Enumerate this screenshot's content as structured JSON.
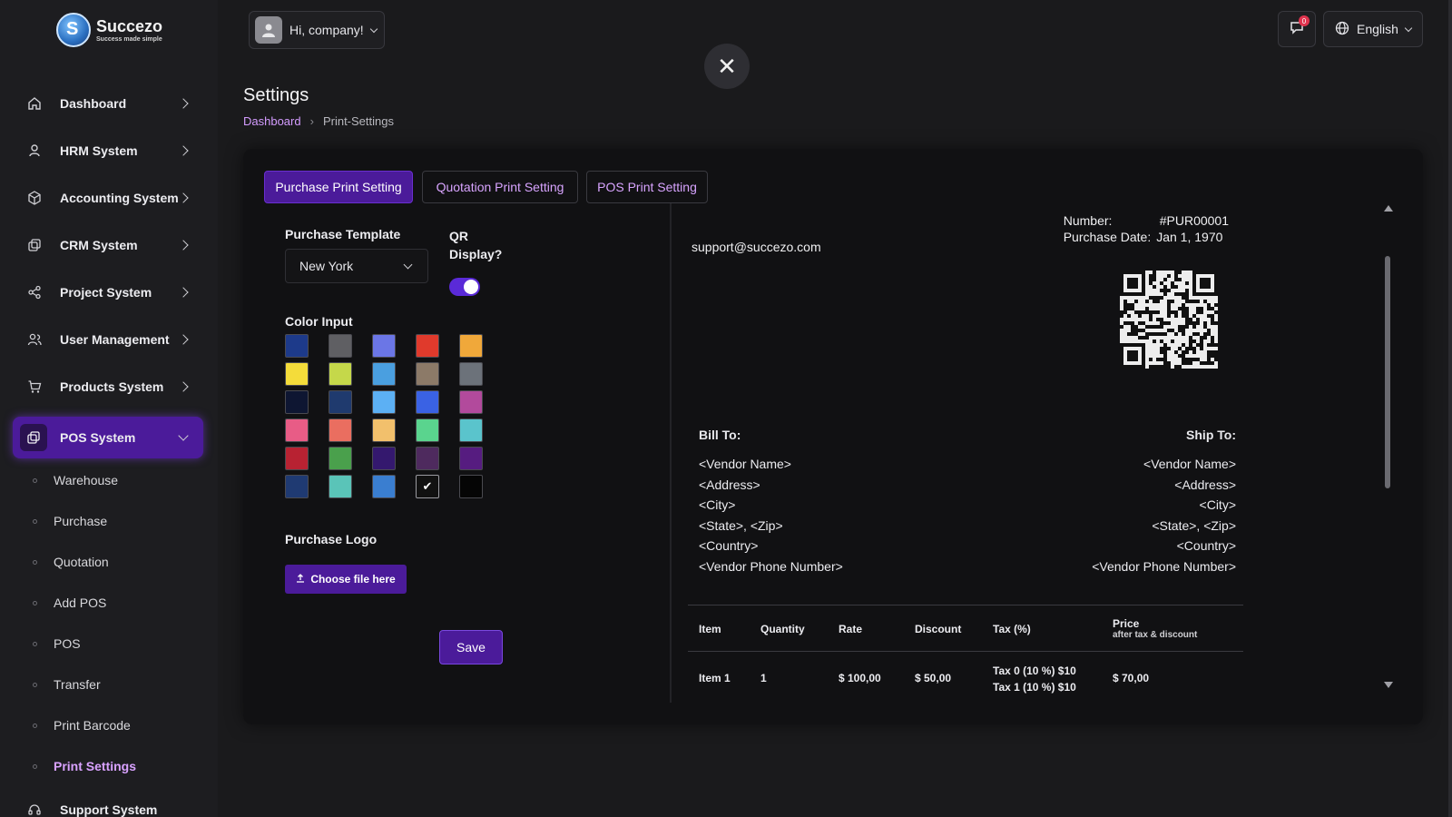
{
  "brand": {
    "name": "Succezo",
    "tagline": "Success made simple",
    "mark": "S"
  },
  "header": {
    "user_label": "Hi, company!",
    "notifications_count": "0",
    "language": "English"
  },
  "sidebar": {
    "items": [
      {
        "label": "Dashboard",
        "icon": "home-icon"
      },
      {
        "label": "HRM System",
        "icon": "user-icon"
      },
      {
        "label": "Accounting System",
        "icon": "box-icon"
      },
      {
        "label": "CRM System",
        "icon": "layers-icon"
      },
      {
        "label": "Project System",
        "icon": "share-icon"
      },
      {
        "label": "User Management",
        "icon": "users-icon"
      },
      {
        "label": "Products System",
        "icon": "cart-icon"
      },
      {
        "label": "POS System",
        "icon": "layers-icon"
      }
    ],
    "pos_children": [
      {
        "label": "Warehouse"
      },
      {
        "label": "Purchase"
      },
      {
        "label": "Quotation"
      },
      {
        "label": "Add POS"
      },
      {
        "label": "POS"
      },
      {
        "label": "Transfer"
      },
      {
        "label": "Print Barcode"
      },
      {
        "label": "Print Settings"
      }
    ],
    "bottom_item": {
      "label": "Support System",
      "icon": "headset-icon"
    }
  },
  "page": {
    "title": "Settings",
    "breadcrumb": {
      "home": "Dashboard",
      "current": "Print-Settings"
    }
  },
  "tabs": [
    {
      "label": "Purchase Print Setting"
    },
    {
      "label": "Quotation Print Setting"
    },
    {
      "label": "POS Print Setting"
    }
  ],
  "form": {
    "template_label": "Purchase Template",
    "template_value": "New York",
    "qr_label": "QR Display?",
    "qr_enabled": true,
    "color_label": "Color Input",
    "logo_label": "Purchase Logo",
    "upload_label": "Choose file here",
    "save_label": "Save",
    "colors": [
      "#1d3a8a",
      "#5f5f63",
      "#6b76e6",
      "#e03a2c",
      "#f0a83a",
      "#f4dc3a",
      "#c5d84a",
      "#4a9fe0",
      "#8c7a68",
      "#6c727a",
      "#0e1632",
      "#1f3a6e",
      "#5cb0f4",
      "#3a62e4",
      "#b24a9c",
      "#e85c86",
      "#ea6e60",
      "#f2c06c",
      "#5ad48e",
      "#5ac4cc",
      "#b82232",
      "#4aa04c",
      "#34186e",
      "#4e2a5e",
      "#561c80",
      "#1f3a72",
      "#5ac4b8",
      "#3a7ed0",
      "#111111",
      "#050505"
    ],
    "selected_color_index": 28
  },
  "preview": {
    "email": "support@succezo.com",
    "number_label": "Number:",
    "number_value": "#PUR00001",
    "date_label": "Purchase Date:",
    "date_value": "Jan 1, 1970",
    "bill_to": "Bill To:",
    "ship_to": "Ship To:",
    "address_lines": [
      "<Vendor Name>",
      "<Address>",
      "<City>",
      "<State>, <Zip>",
      "<Country>",
      "<Vendor Phone Number>"
    ],
    "table": {
      "headers": [
        "Item",
        "Quantity",
        "Rate",
        "Discount",
        "Tax (%)",
        "Price"
      ],
      "price_sub": "after tax & discount",
      "row": {
        "item": "Item 1",
        "quantity": "1",
        "rate": "$ 100,00",
        "discount": "$ 50,00",
        "tax_line1": "Tax 0 (10 %) $10",
        "tax_line2": "Tax 1 (10 %) $10",
        "price": "$ 70,00"
      }
    }
  }
}
